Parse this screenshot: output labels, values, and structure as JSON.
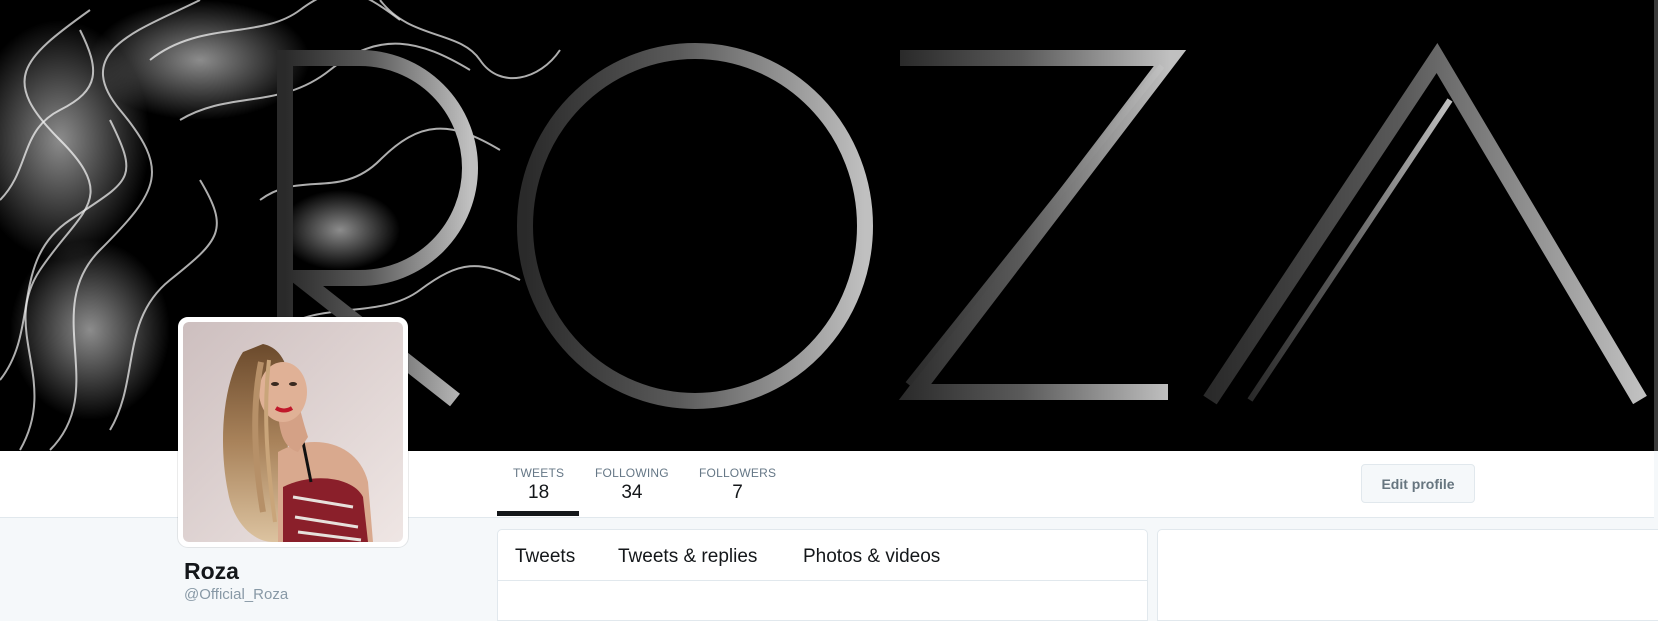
{
  "banner": {
    "wordmark": "ROZA"
  },
  "profile": {
    "name": "Roza",
    "handle": "@Official_Roza"
  },
  "stats": [
    {
      "label": "TWEETS",
      "value": "18",
      "active": true
    },
    {
      "label": "FOLLOWING",
      "value": "34",
      "active": false
    },
    {
      "label": "FOLLOWERS",
      "value": "7",
      "active": false
    }
  ],
  "actions": {
    "edit_profile": "Edit profile"
  },
  "tabs": [
    {
      "label": "Tweets"
    },
    {
      "label": "Tweets & replies"
    },
    {
      "label": "Photos & videos"
    }
  ],
  "colors": {
    "banner_bg": "#000000",
    "page_bg": "#f5f8fa",
    "text_primary": "#14171a",
    "text_secondary": "#657786",
    "handle": "#8899a6"
  }
}
